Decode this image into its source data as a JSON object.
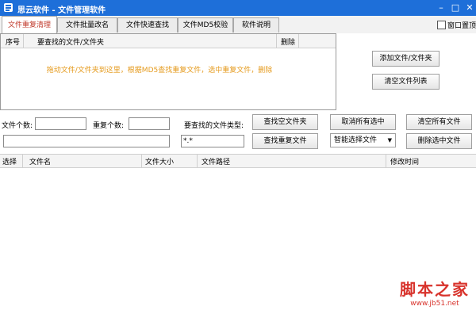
{
  "window": {
    "title": "思云软件 - 文件管理软件"
  },
  "tabs": [
    {
      "label": "文件重复清理"
    },
    {
      "label": "文件批量改名"
    },
    {
      "label": "文件快速查找"
    },
    {
      "label": "文件MD5校验"
    },
    {
      "label": "软件说明"
    }
  ],
  "topmost": {
    "label": "窗口置顶"
  },
  "drop_panel": {
    "col_index": "序号",
    "col_path": "要查找的文件/文件夹",
    "col_delete": "删除",
    "hint": "拖动文件/文件夹到这里，根据MD5查找重复文件，选中重复文件，删除"
  },
  "buttons": {
    "add": "添加文件/文件夹",
    "clear_list": "清空文件列表",
    "find_folder": "查找空文件夹",
    "cancel_all": "取消所有选中",
    "clear_all": "清空所有文件",
    "find_dup": "查找重复文件",
    "delete_sel": "删除选中文件"
  },
  "fields": {
    "file_count_label": "文件个数:",
    "file_count_value": "",
    "dup_count_label": "重复个数:",
    "dup_count_value": "",
    "type_label": "要查找的文件类型:",
    "type_value": "*.*",
    "status_value": ""
  },
  "smart_select": {
    "value": "智能选择文件"
  },
  "grid": {
    "columns": [
      "选择",
      "文件名",
      "文件大小",
      "文件路径",
      "修改时间"
    ]
  },
  "watermark": {
    "text": "脚本之家",
    "url": "www.jb51.net"
  }
}
